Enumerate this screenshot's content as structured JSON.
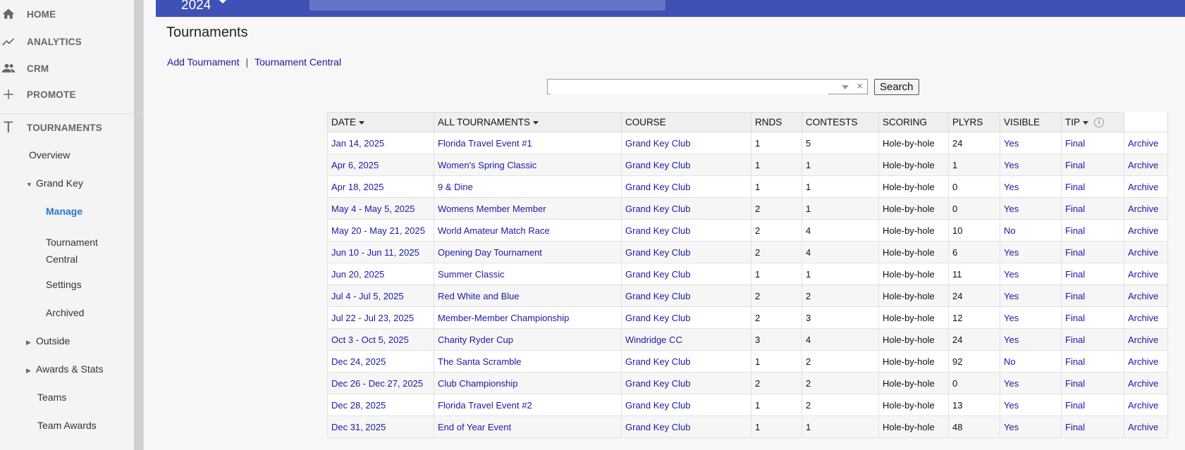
{
  "sidebar": {
    "main": [
      {
        "label": "HOME",
        "icon": "home-icon"
      },
      {
        "label": "ANALYTICS",
        "icon": "analytics-icon"
      },
      {
        "label": "CRM",
        "icon": "people-icon"
      },
      {
        "label": "PROMOTE",
        "icon": "plus-icon"
      },
      {
        "label": "TOURNAMENTS",
        "icon": "tournaments-icon"
      }
    ],
    "sub": {
      "overview": "Overview",
      "grand_key": "Grand Key",
      "manage": "Manage",
      "tournament_central_1": "Tournament",
      "tournament_central_2": "Central",
      "settings": "Settings",
      "archived": "Archived",
      "outside": "Outside",
      "awards_stats": "Awards & Stats",
      "teams": "Teams",
      "team_awards": "Team Awards"
    }
  },
  "topbar": {
    "year": "2024"
  },
  "page": {
    "title": "Tournaments",
    "add_tournament": "Add Tournament",
    "separator": "|",
    "tournament_central": "Tournament Central"
  },
  "search": {
    "placeholder": "",
    "clear": "×",
    "button": "Search"
  },
  "table": {
    "headers": {
      "date": "DATE",
      "all_tournaments": "ALL TOURNAMENTS",
      "course": "COURSE",
      "rnds": "RNDS",
      "contests": "CONTESTS",
      "scoring": "SCORING",
      "plyrs": "PLYRS",
      "visible": "VISIBLE",
      "tip": "TIP",
      "info": "i"
    },
    "rows": [
      {
        "date": "Jan 14, 2025",
        "name": "Florida Travel Event #1",
        "course": "Grand Key Club",
        "rnds": "1",
        "contests": "5",
        "scoring": "Hole-by-hole",
        "plyrs": "24",
        "visible": "Yes",
        "tip": "Final",
        "action": "Archive"
      },
      {
        "date": "Apr 6, 2025",
        "name": "Women's Spring Classic",
        "course": "Grand Key Club",
        "rnds": "1",
        "contests": "1",
        "scoring": "Hole-by-hole",
        "plyrs": "1",
        "visible": "Yes",
        "tip": "Final",
        "action": "Archive"
      },
      {
        "date": "Apr 18, 2025",
        "name": "9 & Dine",
        "course": "Grand Key Club",
        "rnds": "1",
        "contests": "1",
        "scoring": "Hole-by-hole",
        "plyrs": "0",
        "visible": "Yes",
        "tip": "Final",
        "action": "Archive"
      },
      {
        "date": "May 4 - May 5, 2025",
        "name": "Womens Member Member",
        "course": "Grand Key Club",
        "rnds": "2",
        "contests": "1",
        "scoring": "Hole-by-hole",
        "plyrs": "0",
        "visible": "Yes",
        "tip": "Final",
        "action": "Archive"
      },
      {
        "date": "May 20 - May 21, 2025",
        "name": "World Amateur Match Race",
        "course": "Grand Key Club",
        "rnds": "2",
        "contests": "4",
        "scoring": "Hole-by-hole",
        "plyrs": "10",
        "visible": "No",
        "tip": "Final",
        "action": "Archive"
      },
      {
        "date": "Jun 10 - Jun 11, 2025",
        "name": "Opening Day Tournament",
        "course": "Grand Key Club",
        "rnds": "2",
        "contests": "4",
        "scoring": "Hole-by-hole",
        "plyrs": "6",
        "visible": "Yes",
        "tip": "Final",
        "action": "Archive"
      },
      {
        "date": "Jun 20, 2025",
        "name": "Summer Classic",
        "course": "Grand Key Club",
        "rnds": "1",
        "contests": "1",
        "scoring": "Hole-by-hole",
        "plyrs": "11",
        "visible": "Yes",
        "tip": "Final",
        "action": "Archive"
      },
      {
        "date": "Jul 4 - Jul 5, 2025",
        "name": "Red White and Blue",
        "course": "Grand Key Club",
        "rnds": "2",
        "contests": "2",
        "scoring": "Hole-by-hole",
        "plyrs": "24",
        "visible": "Yes",
        "tip": "Final",
        "action": "Archive"
      },
      {
        "date": "Jul 22 - Jul 23, 2025",
        "name": "Member-Member Championship",
        "course": "Grand Key Club",
        "rnds": "2",
        "contests": "3",
        "scoring": "Hole-by-hole",
        "plyrs": "12",
        "visible": "Yes",
        "tip": "Final",
        "action": "Archive"
      },
      {
        "date": "Oct 3 - Oct 5, 2025",
        "name": "Charity Ryder Cup",
        "course": "Windridge CC",
        "rnds": "3",
        "contests": "4",
        "scoring": "Hole-by-hole",
        "plyrs": "24",
        "visible": "Yes",
        "tip": "Final",
        "action": "Archive"
      },
      {
        "date": "Dec 24, 2025",
        "name": "The Santa Scramble",
        "course": "Grand Key Club",
        "rnds": "1",
        "contests": "2",
        "scoring": "Hole-by-hole",
        "plyrs": "92",
        "visible": "No",
        "tip": "Final",
        "action": "Archive"
      },
      {
        "date": "Dec 26 - Dec 27, 2025",
        "name": "Club Championship",
        "course": "Grand Key Club",
        "rnds": "2",
        "contests": "2",
        "scoring": "Hole-by-hole",
        "plyrs": "0",
        "visible": "Yes",
        "tip": "Final",
        "action": "Archive"
      },
      {
        "date": "Dec 28, 2025",
        "name": "Florida Travel Event #2",
        "course": "Grand Key Club",
        "rnds": "1",
        "contests": "2",
        "scoring": "Hole-by-hole",
        "plyrs": "13",
        "visible": "Yes",
        "tip": "Final",
        "action": "Archive"
      },
      {
        "date": "Dec 31, 2025",
        "name": "End of Year Event",
        "course": "Grand Key Club",
        "rnds": "1",
        "contests": "1",
        "scoring": "Hole-by-hole",
        "plyrs": "48",
        "visible": "Yes",
        "tip": "Final",
        "action": "Archive"
      }
    ]
  },
  "colors": {
    "topbar": "#3f51b5",
    "link": "#1a1aa6",
    "active_nav": "#2a76c8"
  }
}
